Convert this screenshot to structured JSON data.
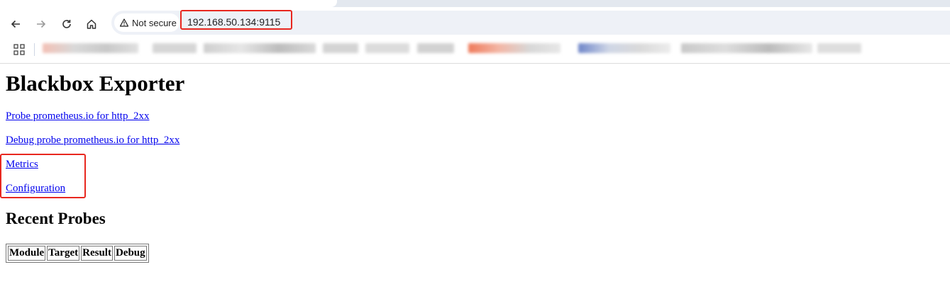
{
  "browser": {
    "security_label": "Not secure",
    "url": "192.168.50.134:9115",
    "icons": {
      "back": "back-arrow-icon",
      "forward": "forward-arrow-icon",
      "reload": "reload-icon",
      "home": "home-icon",
      "security": "warning-triangle-icon",
      "apps": "apps-grid-icon"
    },
    "highlight_color": "#e8271f"
  },
  "page": {
    "title": "Blackbox Exporter",
    "links": {
      "probe": "Probe prometheus.io for http_2xx",
      "debug_probe": "Debug probe prometheus.io for http_2xx",
      "metrics": "Metrics",
      "configuration": "Configuration"
    },
    "recent_probes": {
      "title": "Recent Probes",
      "columns": [
        "Module",
        "Target",
        "Result",
        "Debug"
      ]
    }
  }
}
